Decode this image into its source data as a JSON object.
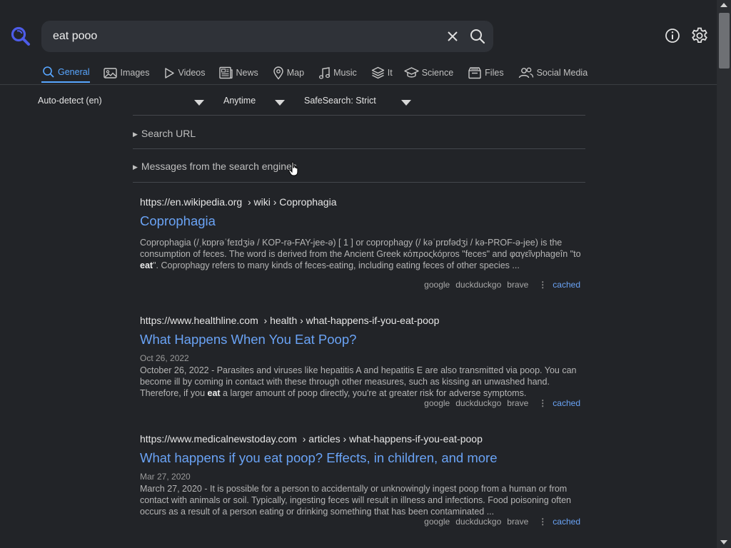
{
  "search": {
    "value": "eat pooo",
    "placeholder": ""
  },
  "tabs": [
    {
      "label": "General",
      "icon": "search-icon"
    },
    {
      "label": "Images",
      "icon": "image-icon"
    },
    {
      "label": "Videos",
      "icon": "play-icon"
    },
    {
      "label": "News",
      "icon": "newspaper-icon"
    },
    {
      "label": "Map",
      "icon": "map-pin-icon"
    },
    {
      "label": "Music",
      "icon": "music-note-icon"
    },
    {
      "label": "It",
      "icon": "layers-icon"
    },
    {
      "label": "Science",
      "icon": "graduation-cap-icon"
    },
    {
      "label": "Files",
      "icon": "file-box-icon"
    },
    {
      "label": "Social Media",
      "icon": "people-icon"
    }
  ],
  "filters": {
    "language": "Auto-detect (en)",
    "time": "Anytime",
    "safesearch": "SafeSearch: Strict"
  },
  "details": {
    "search_url": "Search URL",
    "messages": "Messages from the search engines"
  },
  "results": [
    {
      "host": "https://en.wikipedia.org",
      "path": "› wiki › Coprophagia",
      "title": "Coprophagia",
      "date": "",
      "snippet_before": "Coprophagia (/ˌkɒprəˈfeɪdʒiə / KOP-rə-FAY-jee-ə) [ 1 ] or coprophagy (/ kəˈprɒfədʒi / kə-PROF-ə-jee) is the consumption of feces. The word is derived from the Ancient Greek κόπροςkópros \"feces\" and φαγεῖνphageîn \"to ",
      "snippet_bold": "eat",
      "snippet_after": "\". Coprophagy refers to many kinds of feces-eating, including eating feces of other species ...",
      "engines": [
        "google",
        "duckduckgo",
        "brave"
      ],
      "cached": "cached"
    },
    {
      "host": "https://www.healthline.com",
      "path": "› health › what-happens-if-you-eat-poop",
      "title": "What Happens When You Eat Poop?",
      "date": "Oct 26, 2022",
      "snippet_before": "October 26, 2022 - Parasites and viruses like hepatitis A and hepatitis E are also transmitted via poop. You can become ill by coming in contact with these through other measures, such as kissing an unwashed hand. Therefore, if you ",
      "snippet_bold": "eat",
      "snippet_after": " a larger amount of poop directly, you're at greater risk for adverse symptoms.",
      "engines": [
        "google",
        "duckduckgo",
        "brave"
      ],
      "cached": "cached"
    },
    {
      "host": "https://www.medicalnewstoday.com",
      "path": "› articles › what-happens-if-you-eat-poop",
      "title": "What happens if you eat poop? Effects, in children, and more",
      "date": "Mar 27, 2020",
      "snippet_before": "March 27, 2020 - It is possible for a person to accidentally or unknowingly ingest poop from a human or from contact with animals or soil. Typically, ingesting feces will result in illness and infections. Food poisoning often occurs as a result of a person eating or drinking something that has been contaminated ...",
      "snippet_bold": "",
      "snippet_after": "",
      "engines": [
        "google",
        "duckduckgo",
        "brave"
      ],
      "cached": "cached"
    }
  ],
  "colors": {
    "background": "#222428",
    "accent": "#58a6ff",
    "link": "#6aa3f5",
    "logo": "#4d5ce8"
  }
}
